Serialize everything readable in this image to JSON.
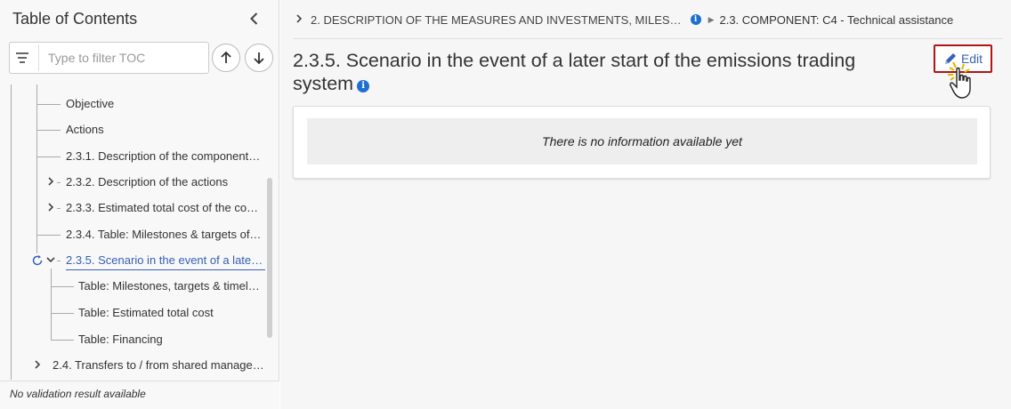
{
  "toc": {
    "title": "Table of Contents",
    "filter_placeholder": "Type to filter TOC",
    "items": [
      {
        "label": "Objective"
      },
      {
        "label": "Actions"
      },
      {
        "label": "2.3.1. Description of the component…"
      },
      {
        "label": "2.3.2. Description of the actions"
      },
      {
        "label": "2.3.3. Estimated total cost of the co…"
      },
      {
        "label": "2.3.4. Table: Milestones & targets of…"
      },
      {
        "label": "2.3.5. Scenario in the event of a late…"
      },
      {
        "label": "Table: Milestones, targets & timeli…"
      },
      {
        "label": "Table: Estimated total cost"
      },
      {
        "label": "Table: Financing"
      },
      {
        "label": "2.4. Transfers to / from shared manage…"
      }
    ],
    "footer": "No validation result available"
  },
  "breadcrumb": {
    "parent": "2. DESCRIPTION OF THE MEASURES AND INVESTMENTS, MILES…",
    "current": "2.3. COMPONENT: C4 - Technical assistance"
  },
  "page": {
    "title": "2.3.5. Scenario in the event of a later start of the emissions trading system",
    "edit_label": "Edit",
    "empty_message": "There is no information available yet"
  },
  "colors": {
    "accent": "#3661b5",
    "highlight_border": "#b31313",
    "info": "#1f6fd0"
  }
}
